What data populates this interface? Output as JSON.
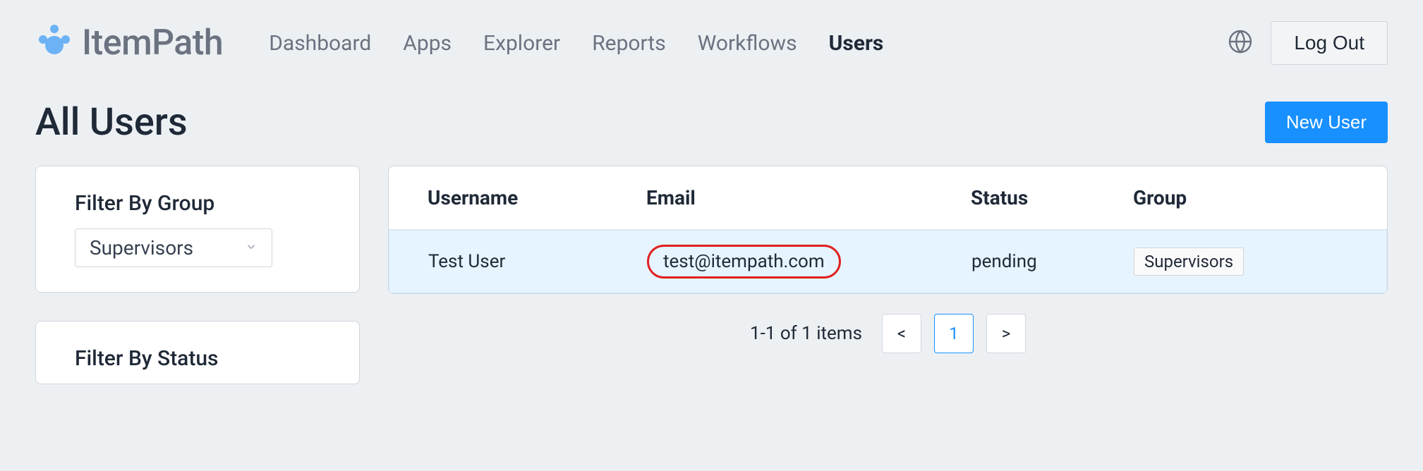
{
  "brand": {
    "name": "ItemPath"
  },
  "nav": {
    "items": [
      {
        "label": "Dashboard",
        "active": false
      },
      {
        "label": "Apps",
        "active": false
      },
      {
        "label": "Explorer",
        "active": false
      },
      {
        "label": "Reports",
        "active": false
      },
      {
        "label": "Workflows",
        "active": false
      },
      {
        "label": "Users",
        "active": true
      }
    ]
  },
  "header": {
    "logout_label": "Log Out"
  },
  "page": {
    "title": "All Users",
    "new_user_label": "New User"
  },
  "filters": {
    "group": {
      "title": "Filter By Group",
      "selected": "Supervisors"
    },
    "status": {
      "title": "Filter By Status"
    }
  },
  "table": {
    "columns": {
      "username": "Username",
      "email": "Email",
      "status": "Status",
      "group": "Group"
    },
    "rows": [
      {
        "username": "Test User",
        "email": "test@itempath.com",
        "status": "pending",
        "group": "Supervisors"
      }
    ]
  },
  "pagination": {
    "summary": "1-1 of 1 items",
    "prev": "<",
    "current": "1",
    "next": ">"
  }
}
